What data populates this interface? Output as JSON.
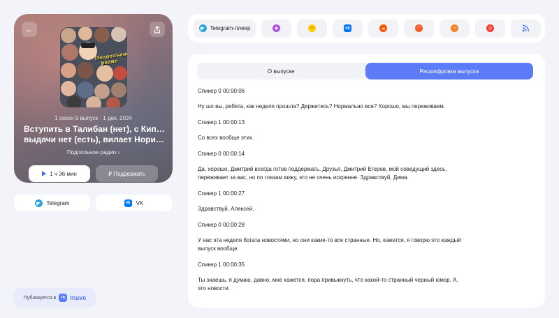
{
  "episode": {
    "meta": "1 сезон 9 выпуск · 1 дек. 2024",
    "title_line1": "Вступить в Талибан (нет), с Кипра",
    "title_line2": "выдачи нет (есть), вилает Норильск…",
    "podcast": "Подпольное радио ›",
    "cover_text": "Подпольное радио",
    "play_label": "1 ч 36 мин",
    "support_label": "₽ Поддержать"
  },
  "share": {
    "telegram": "Telegram",
    "vk": "VK"
  },
  "publisher": {
    "prefix": "Публикуется в",
    "brand": "mave"
  },
  "platforms": {
    "telegram_player": "Telegram-плеер",
    "items": [
      "apple-podcasts",
      "yandex-music",
      "vk",
      "soundcloud",
      "castbox",
      "pocket-casts",
      "podcast-addict",
      "rss"
    ]
  },
  "tabs": {
    "about": "О выпуске",
    "transcript": "Расшифровка выпуска"
  },
  "transcript": [
    {
      "speaker": "Спикер 0 00:00:06",
      "text": "Ну шо вы, ребята, как неделя прошла? Держитесь? Нормально все? Хорошо, мы переживаем."
    },
    {
      "speaker": "Спикер 1 00:00:13",
      "text": "Со всех вообще этих."
    },
    {
      "speaker": "Спикер 0 00:00:14",
      "text": "Да, хорошо, Дмитрий всегда готов поддержать. Друзья, Дмитрий Егоров, мой соведущий здесь, переживает за вас, но по глазам вижу, это не очень искренне. Здравствуй, Дима."
    },
    {
      "speaker": "Спикер 1 00:00:27",
      "text": "Здравствуй, Алексей."
    },
    {
      "speaker": "Спикер 0 00:00:28",
      "text": "У нас эта неделя богата новостями, но они какие-то все странные. Но, кажется, я говорю это каждый выпуск вообще."
    },
    {
      "speaker": "Спикер 1 00:00:35",
      "text": "Ты знаешь, я думаю, давно, мне кажется, пора привыкнуть, что какой-то странный черный юмор. А, это новости."
    }
  ],
  "colors": {
    "accent": "#5b7cf6",
    "background": "#f3f4f9"
  }
}
